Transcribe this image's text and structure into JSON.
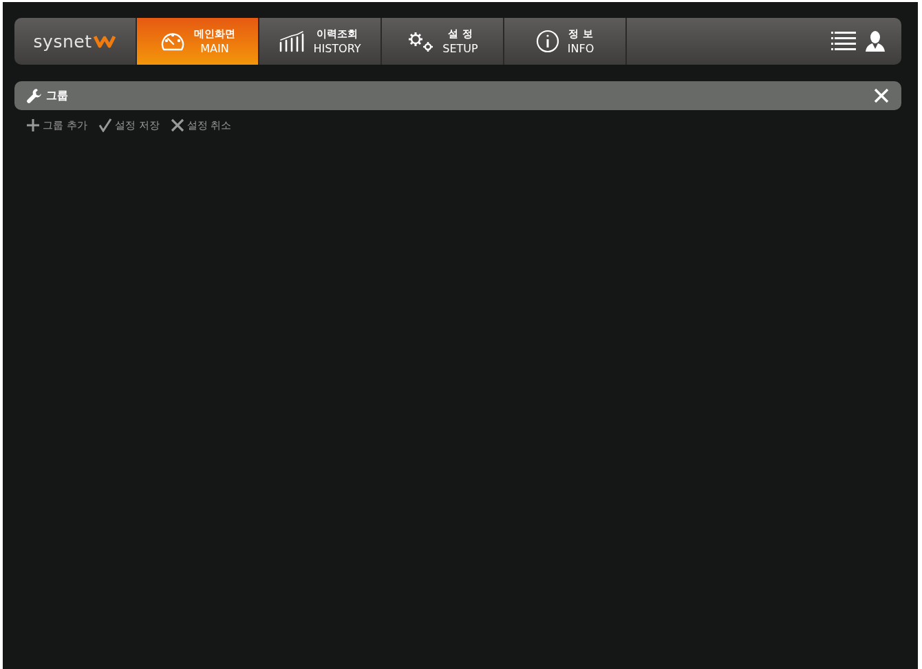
{
  "brand": {
    "name": "sysnet"
  },
  "tabs": [
    {
      "label": "메인화면",
      "sublabel": "MAIN",
      "kind": "gauge",
      "selected": true
    },
    {
      "label": "이력조회",
      "sublabel": "HISTORY",
      "kind": "chart",
      "selected": false
    },
    {
      "label": "설 정",
      "sublabel": "SETUP",
      "kind": "gears",
      "selected": false
    },
    {
      "label": "정 보",
      "sublabel": "INFO",
      "kind": "info",
      "selected": false
    }
  ],
  "panel": {
    "title": "그룹"
  },
  "actions": [
    {
      "label": "그룹 추가",
      "kind": "plus"
    },
    {
      "label": "설정 저장",
      "kind": "check"
    },
    {
      "label": "설정 취소",
      "kind": "cross"
    }
  ]
}
